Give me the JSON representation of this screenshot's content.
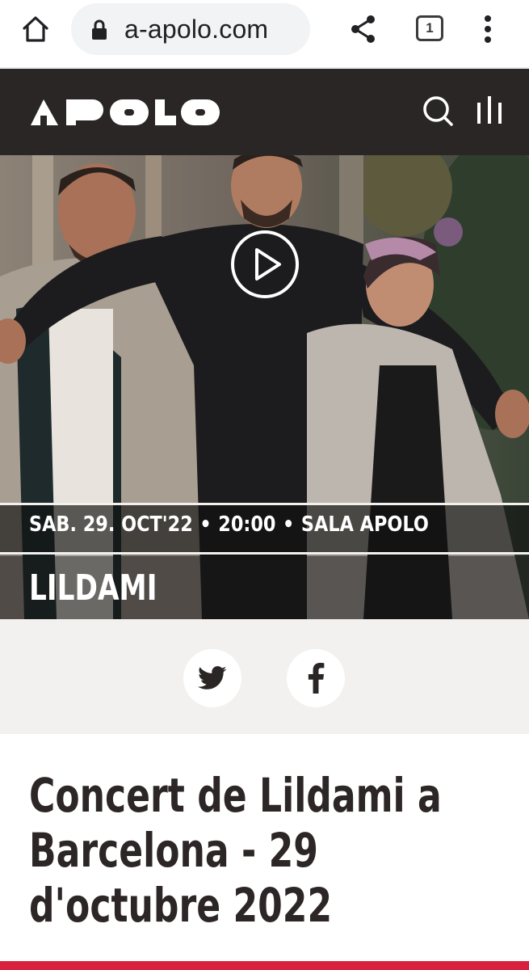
{
  "browser": {
    "url": "a-apolo.com",
    "tab_count": "1",
    "icons": [
      "home-icon",
      "lock-icon",
      "share-icon",
      "tabs-icon",
      "more-vert-icon"
    ]
  },
  "site": {
    "logo_text": "APOLO",
    "header_bg": "#2b2626",
    "icons": [
      "search-icon",
      "menu-bars-icon"
    ]
  },
  "event": {
    "date": "SAB. 29. OCT'22",
    "time": "20:00",
    "venue": "SALA APOLO",
    "separator": "•",
    "name": "LILDAMI"
  },
  "share": {
    "icons": [
      "twitter-icon",
      "facebook-icon"
    ]
  },
  "content": {
    "title": "Concert de Lildami a Barcelona - 29 d'octubre 2022"
  },
  "colors": {
    "accent_red": "#d8203f",
    "text_dark": "#2d2626",
    "share_bg": "#f3f1ef"
  }
}
